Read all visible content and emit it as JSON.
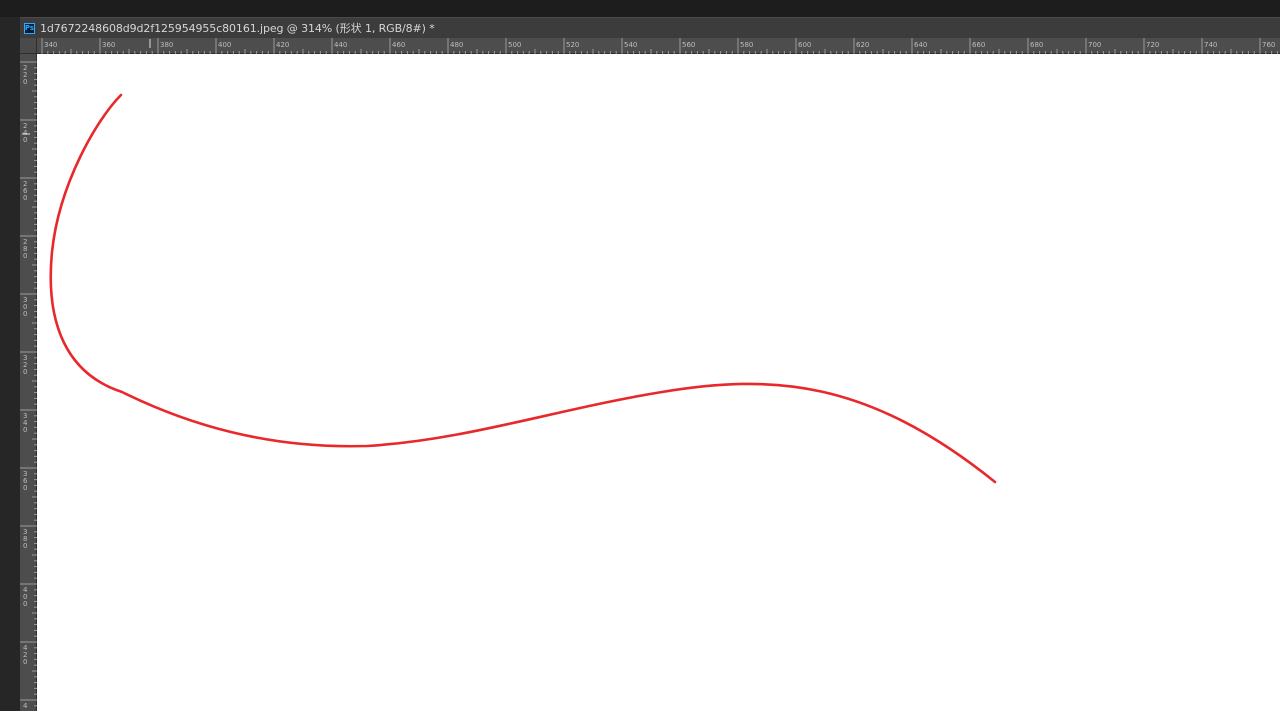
{
  "document": {
    "title": "1d7672248608d9d2f125954955c80161.jpeg @ 314% (形状 1, RGB/8#) *",
    "app_icon": "ps-app-icon",
    "app_icon_text": "Ps"
  },
  "rulers": {
    "horizontal_labels": [
      "340",
      "360",
      "380",
      "400",
      "420",
      "440",
      "460",
      "480",
      "500",
      "520",
      "540",
      "560",
      "580",
      "600",
      "620",
      "640",
      "660",
      "680",
      "700",
      "720",
      "740",
      "760"
    ],
    "vertical_labels": [
      "220",
      "240",
      "260",
      "280",
      "300",
      "320",
      "340",
      "360",
      "380",
      "400",
      "420",
      "4"
    ]
  },
  "canvas": {
    "background": "#ffffff",
    "stroke_color": "#e8282b"
  }
}
